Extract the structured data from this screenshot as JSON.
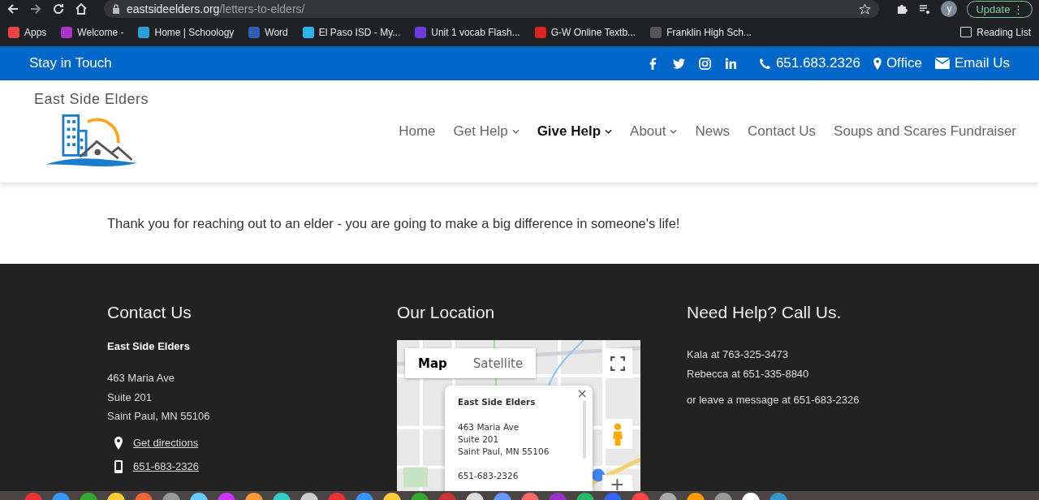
{
  "browser": {
    "url_host": "eastsideelders.org",
    "url_path": "/letters-to-elders/",
    "avatar": "y",
    "update_button": "Update",
    "menu_glyph": "⋮",
    "bookmarks": [
      {
        "label": "Apps",
        "kind": "apps"
      },
      {
        "label": "Welcome -",
        "kind": "f"
      },
      {
        "label": "Home | Schoology",
        "kind": "s"
      },
      {
        "label": "Word",
        "kind": "w"
      },
      {
        "label": "El Paso ISD - My...",
        "kind": "cloud"
      },
      {
        "label": "Unit 1 vocab Flash...",
        "kind": "q"
      },
      {
        "label": "G-W Online Textb...",
        "kind": "gw"
      },
      {
        "label": "Franklin High Sch...",
        "kind": "dark"
      }
    ],
    "reading_list": "Reading List"
  },
  "top_bar": {
    "title": "Stay in Touch",
    "social": [
      {
        "kind": "facebook"
      },
      {
        "kind": "twitter"
      },
      {
        "kind": "instagram"
      },
      {
        "kind": "linkedin"
      }
    ],
    "phone": "651.683.2326",
    "office": "Office",
    "email": "Email Us"
  },
  "header": {
    "logo_text": "East Side Elders",
    "nav": [
      {
        "label": "Home",
        "has_menu": false,
        "selected": false
      },
      {
        "label": "Get Help",
        "has_menu": true,
        "selected": false
      },
      {
        "label": "Give Help",
        "has_menu": true,
        "selected": true
      },
      {
        "label": "About",
        "has_menu": true,
        "selected": false
      },
      {
        "label": "News",
        "has_menu": false,
        "selected": false
      },
      {
        "label": "Contact Us",
        "has_menu": false,
        "selected": false
      },
      {
        "label": "Soups and Scares Fundraiser",
        "has_menu": false,
        "selected": false
      }
    ]
  },
  "content": {
    "message": "Thank you for reaching out to an elder - you are going to make a big difference in someone's life!"
  },
  "footer": {
    "contact": {
      "heading": "Contact Us",
      "name": "East Side Elders",
      "address": [
        "463 Maria Ave",
        "Suite 201",
        "Saint Paul, MN 55106"
      ],
      "directions": "Get directions",
      "phone": "651-683-2326"
    },
    "location": {
      "heading": "Our Location",
      "map": {
        "kind": "picture",
        "tabs": [
          {
            "label": "Map",
            "selected": true
          },
          {
            "label": "Satellite",
            "selected": false
          }
        ],
        "close_glyph": "×",
        "zoom_in_glyph": "+",
        "info": {
          "title": "East Side Elders",
          "lines": [
            "463 Maria Ave",
            "Suite 201",
            "Saint Paul, MN 55106"
          ],
          "phone": "651-683-2326"
        }
      }
    },
    "help": {
      "heading": "Need Help?  Call Us.",
      "lines": [
        "Kala at 763-325-3473",
        "Rebecca at 651-335-8840"
      ],
      "note": "or leave a message at 651-683-2326"
    }
  }
}
